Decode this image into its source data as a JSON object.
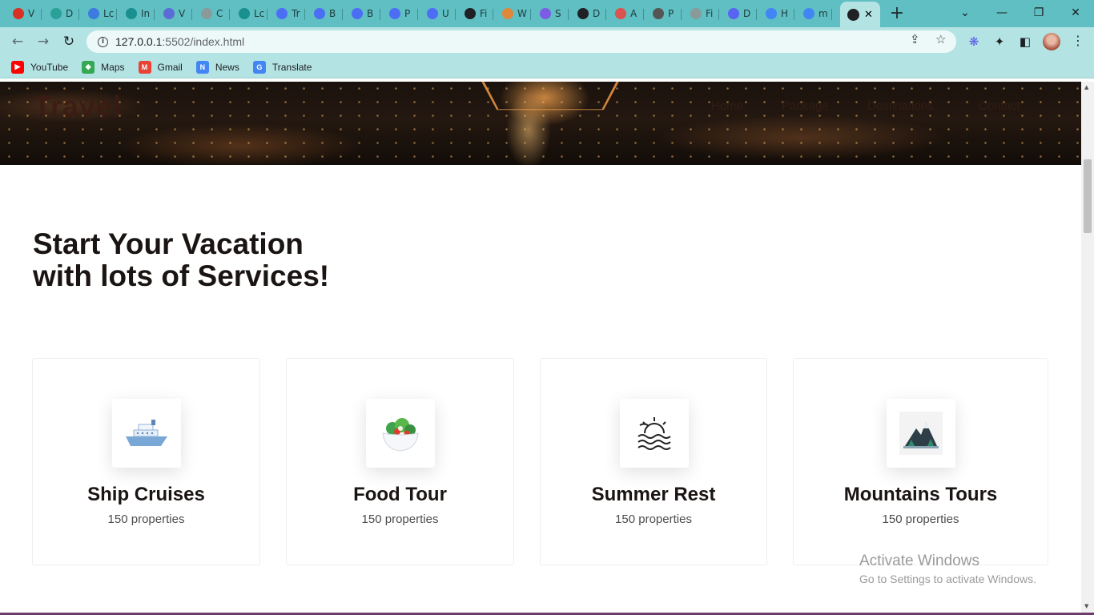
{
  "browser": {
    "tabs": [
      {
        "letter": "V",
        "color": "#d93025"
      },
      {
        "letter": "D",
        "color": "#2aa198"
      },
      {
        "letter": "Lc",
        "color": "#3d7be0"
      },
      {
        "letter": "In",
        "color": "#1a8f8f"
      },
      {
        "letter": "V",
        "color": "#5b6cd6"
      },
      {
        "letter": "C",
        "color": "#8a9a9a"
      },
      {
        "letter": "Lc",
        "color": "#1a8f8f"
      },
      {
        "letter": "Tr",
        "color": "#4c6ef5"
      },
      {
        "letter": "B",
        "color": "#4c6ef5"
      },
      {
        "letter": "B",
        "color": "#4c6ef5"
      },
      {
        "letter": "P",
        "color": "#4c6ef5"
      },
      {
        "letter": "U",
        "color": "#4c6ef5"
      },
      {
        "letter": "Fi",
        "color": "#202124"
      },
      {
        "letter": "W",
        "color": "#e0873a"
      },
      {
        "letter": "S",
        "color": "#7b5ce6"
      },
      {
        "letter": "D",
        "color": "#202124"
      },
      {
        "letter": "A",
        "color": "#d9534f"
      },
      {
        "letter": "P",
        "color": "#555555"
      },
      {
        "letter": "Fi",
        "color": "#8a9a9a"
      },
      {
        "letter": "D",
        "color": "#5865f2"
      },
      {
        "letter": "H",
        "color": "#4285f4"
      },
      {
        "letter": "m",
        "color": "#4285f4"
      }
    ],
    "active_tab_close": "✕",
    "new_tab_symbol": "+",
    "window_controls": {
      "dropdown": "⌄",
      "minimize": "—",
      "restore": "❐",
      "close": "✕"
    },
    "nav": {
      "back": "←",
      "forward": "→",
      "reload": "↻"
    },
    "url_host": "127.0.0.1",
    "url_path": ":5502/index.html",
    "omnibox_icons": {
      "share": "⇪",
      "star": "☆"
    },
    "toolbar_icons": {
      "extension_a": "❋",
      "puzzle": "✦",
      "sidepanel": "◧",
      "menu": "⋮"
    },
    "bookmarks": [
      {
        "label": "YouTube",
        "icon": "youtube-icon",
        "color": "#ff0000",
        "glyph": "▶"
      },
      {
        "label": "Maps",
        "icon": "maps-icon",
        "color": "#34a853",
        "glyph": "◆"
      },
      {
        "label": "Gmail",
        "icon": "gmail-icon",
        "color": "#ea4335",
        "glyph": "M"
      },
      {
        "label": "News",
        "icon": "news-icon",
        "color": "#4285f4",
        "glyph": "N"
      },
      {
        "label": "Translate",
        "icon": "translate-icon",
        "color": "#4285f4",
        "glyph": "G"
      }
    ]
  },
  "page": {
    "logo": "Travel",
    "nav": [
      "Home",
      "Package",
      "Destinations",
      "Contact"
    ],
    "heading_line1": "Start Your Vacation",
    "heading_line2": "with lots of Services!",
    "cards": [
      {
        "title": "Ship Cruises",
        "subtitle": "150 properties",
        "icon": "ship-icon"
      },
      {
        "title": "Food Tour",
        "subtitle": "150 properties",
        "icon": "salad-bowl-icon"
      },
      {
        "title": "Summer Rest",
        "subtitle": "150 properties",
        "icon": "sunset-waves-icon"
      },
      {
        "title": "Mountains Tours",
        "subtitle": "150 properties",
        "icon": "mountain-icon"
      }
    ]
  },
  "os": {
    "watermark_title": "Activate Windows",
    "watermark_sub": "Go to Settings to activate Windows."
  }
}
